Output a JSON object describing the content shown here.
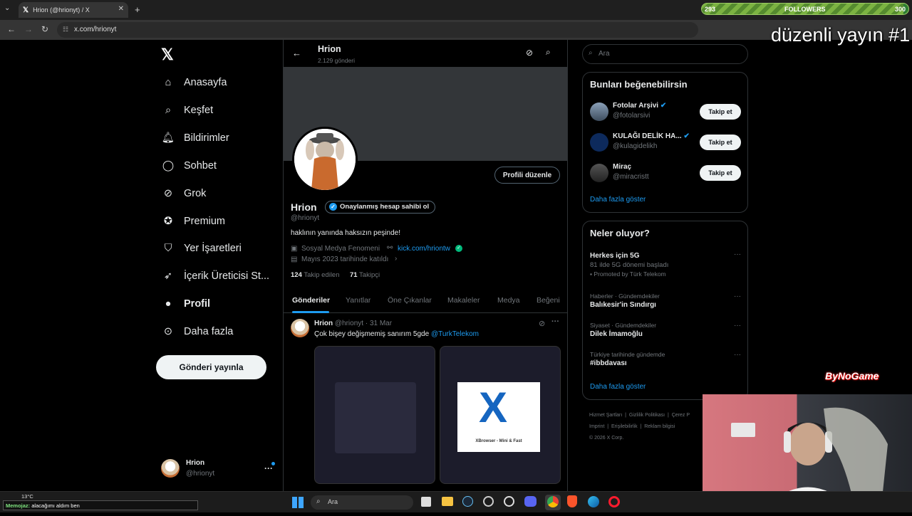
{
  "browser": {
    "tab_title": "Hrion (@hrionyt) / X",
    "tab_icon": "x-logo-icon",
    "url": "x.com/hrionyt"
  },
  "overlay": {
    "followers_label": "FOLLOWERS",
    "followers_current": "293",
    "followers_goal": "300",
    "followers_progress": 0.977,
    "title": "düzenli yayın #1",
    "sponsor": "ByNoGame",
    "ticker_name": "Memojaz:",
    "ticker_text": "alacağımı aldım ben"
  },
  "nav": {
    "items": [
      {
        "label": "Anasayfa",
        "icon": "home-icon"
      },
      {
        "label": "Keşfet",
        "icon": "search-icon"
      },
      {
        "label": "Bildirimler",
        "icon": "bell-icon"
      },
      {
        "label": "Sohbet",
        "icon": "chat-icon"
      },
      {
        "label": "Grok",
        "icon": "grok-icon"
      },
      {
        "label": "Premium",
        "icon": "verified-icon"
      },
      {
        "label": "Yer İşaretleri",
        "icon": "bookmark-icon"
      },
      {
        "label": "İçerik Üreticisi St...",
        "icon": "rocket-icon"
      },
      {
        "label": "Profil",
        "icon": "person-icon"
      },
      {
        "label": "Daha fazla",
        "icon": "more-circle-icon"
      }
    ],
    "post_button": "Gönderi yayınla",
    "account_name": "Hrion",
    "account_handle": "@hrionyt"
  },
  "profile": {
    "header_name": "Hrion",
    "header_posts": "2.129 gönderi",
    "name": "Hrion",
    "verify_badge": "Onaylanmış hesap sahibi ol",
    "handle": "@hrionyt",
    "edit_button": "Profili düzenle",
    "bio": "haklının yanında haksızın peşinde!",
    "category": "Sosyal Medya Fenomeni",
    "link": "kick.com/hriontw",
    "joined": "Mayıs 2023 tarihinde katıldı",
    "following_count": "124",
    "following_label": "Takip edilen",
    "followers_count": "71",
    "followers_label": "Takipçi",
    "tabs": [
      "Gönderiler",
      "Yanıtlar",
      "Öne Çıkanlar",
      "Makaleler",
      "Medya",
      "Beğeni"
    ]
  },
  "post": {
    "name": "Hrion",
    "handle": "@hrionyt",
    "date": "· 31 Mar",
    "text": "Çok bişey değişmemiş sanırım 5gde",
    "mention": "@TurkTelekom",
    "ad_title": "XBrowser - Mini & Fast"
  },
  "right": {
    "search_placeholder": "Ara",
    "suggest_title": "Bunları beğenebilirsin",
    "suggestions": [
      {
        "name": "Fotolar Arşivi",
        "handle": "@fotolarsivi",
        "button": "Takip et"
      },
      {
        "name": "KULAĞI DELİK HA...",
        "handle": "@kulagidelikh",
        "button": "Takip et"
      },
      {
        "name": "Miraç",
        "handle": "@miracristt",
        "button": "Takip et"
      }
    ],
    "show_more": "Daha fazla göster",
    "trends_title": "Neler oluyor?",
    "trends": [
      {
        "context": "",
        "title": "Herkes için 5G",
        "sub": "81 ilde 5G dönemi başladı",
        "promo": "Promoted by Türk Telekom"
      },
      {
        "context": "Haberler · Gündemdekiler",
        "title": "Balıkesir'in Sındırgı",
        "sub": "",
        "promo": ""
      },
      {
        "context": "Siyaset · Gündemdekiler",
        "title": "Dilek İmamoğlu",
        "sub": "",
        "promo": ""
      },
      {
        "context": "Türkiye tarihinde gündemde",
        "title": "#ibbdavası",
        "sub": "",
        "promo": ""
      }
    ],
    "trends_more": "Daha fazla göster",
    "footer": [
      "Hizmet Şartları",
      "Gizlilik Politikası",
      "Çerez P",
      "Imprint",
      "Erişilebilirlik",
      "Reklam bilgisi",
      "© 2026 X Corp."
    ]
  },
  "taskbar": {
    "weather": "13°C",
    "search": "Ara"
  },
  "colors": {
    "accent": "#1d9bf0",
    "bg": "#000000",
    "border": "#2f3336",
    "muted": "#71767b"
  }
}
